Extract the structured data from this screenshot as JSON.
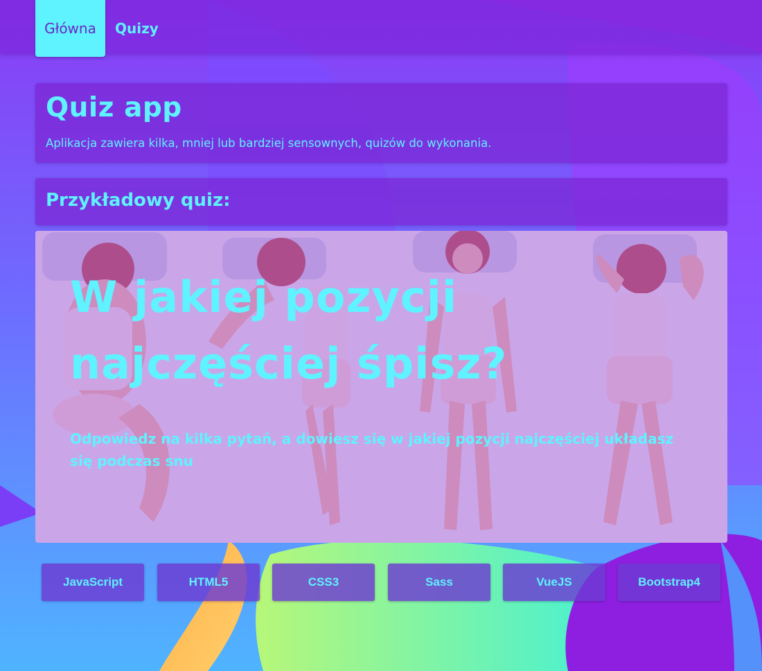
{
  "nav": {
    "items": [
      {
        "label": "Główna",
        "active": true
      },
      {
        "label": "Quizy",
        "active": false
      }
    ]
  },
  "header": {
    "title": "Quiz app",
    "description": "Aplikacja zawiera kilka, mniej lub bardziej sensownych, quizów do wykonania."
  },
  "featured": {
    "heading": "Przykładowy quiz:",
    "quiz_title": "W jakiej pozycji najczęściej śpisz?",
    "quiz_description": "Odpowiedz na kilka pytań, a dowiesz się w jakiej pozycji najczęściej układasz się podczas snu"
  },
  "tech_tags": [
    "JavaScript",
    "HTML5",
    "CSS3",
    "Sass",
    "VueJS",
    "Bootstrap4"
  ],
  "colors": {
    "accent": "#5ff2ff",
    "primary": "#7b26d4",
    "background": "#5b7bff"
  }
}
